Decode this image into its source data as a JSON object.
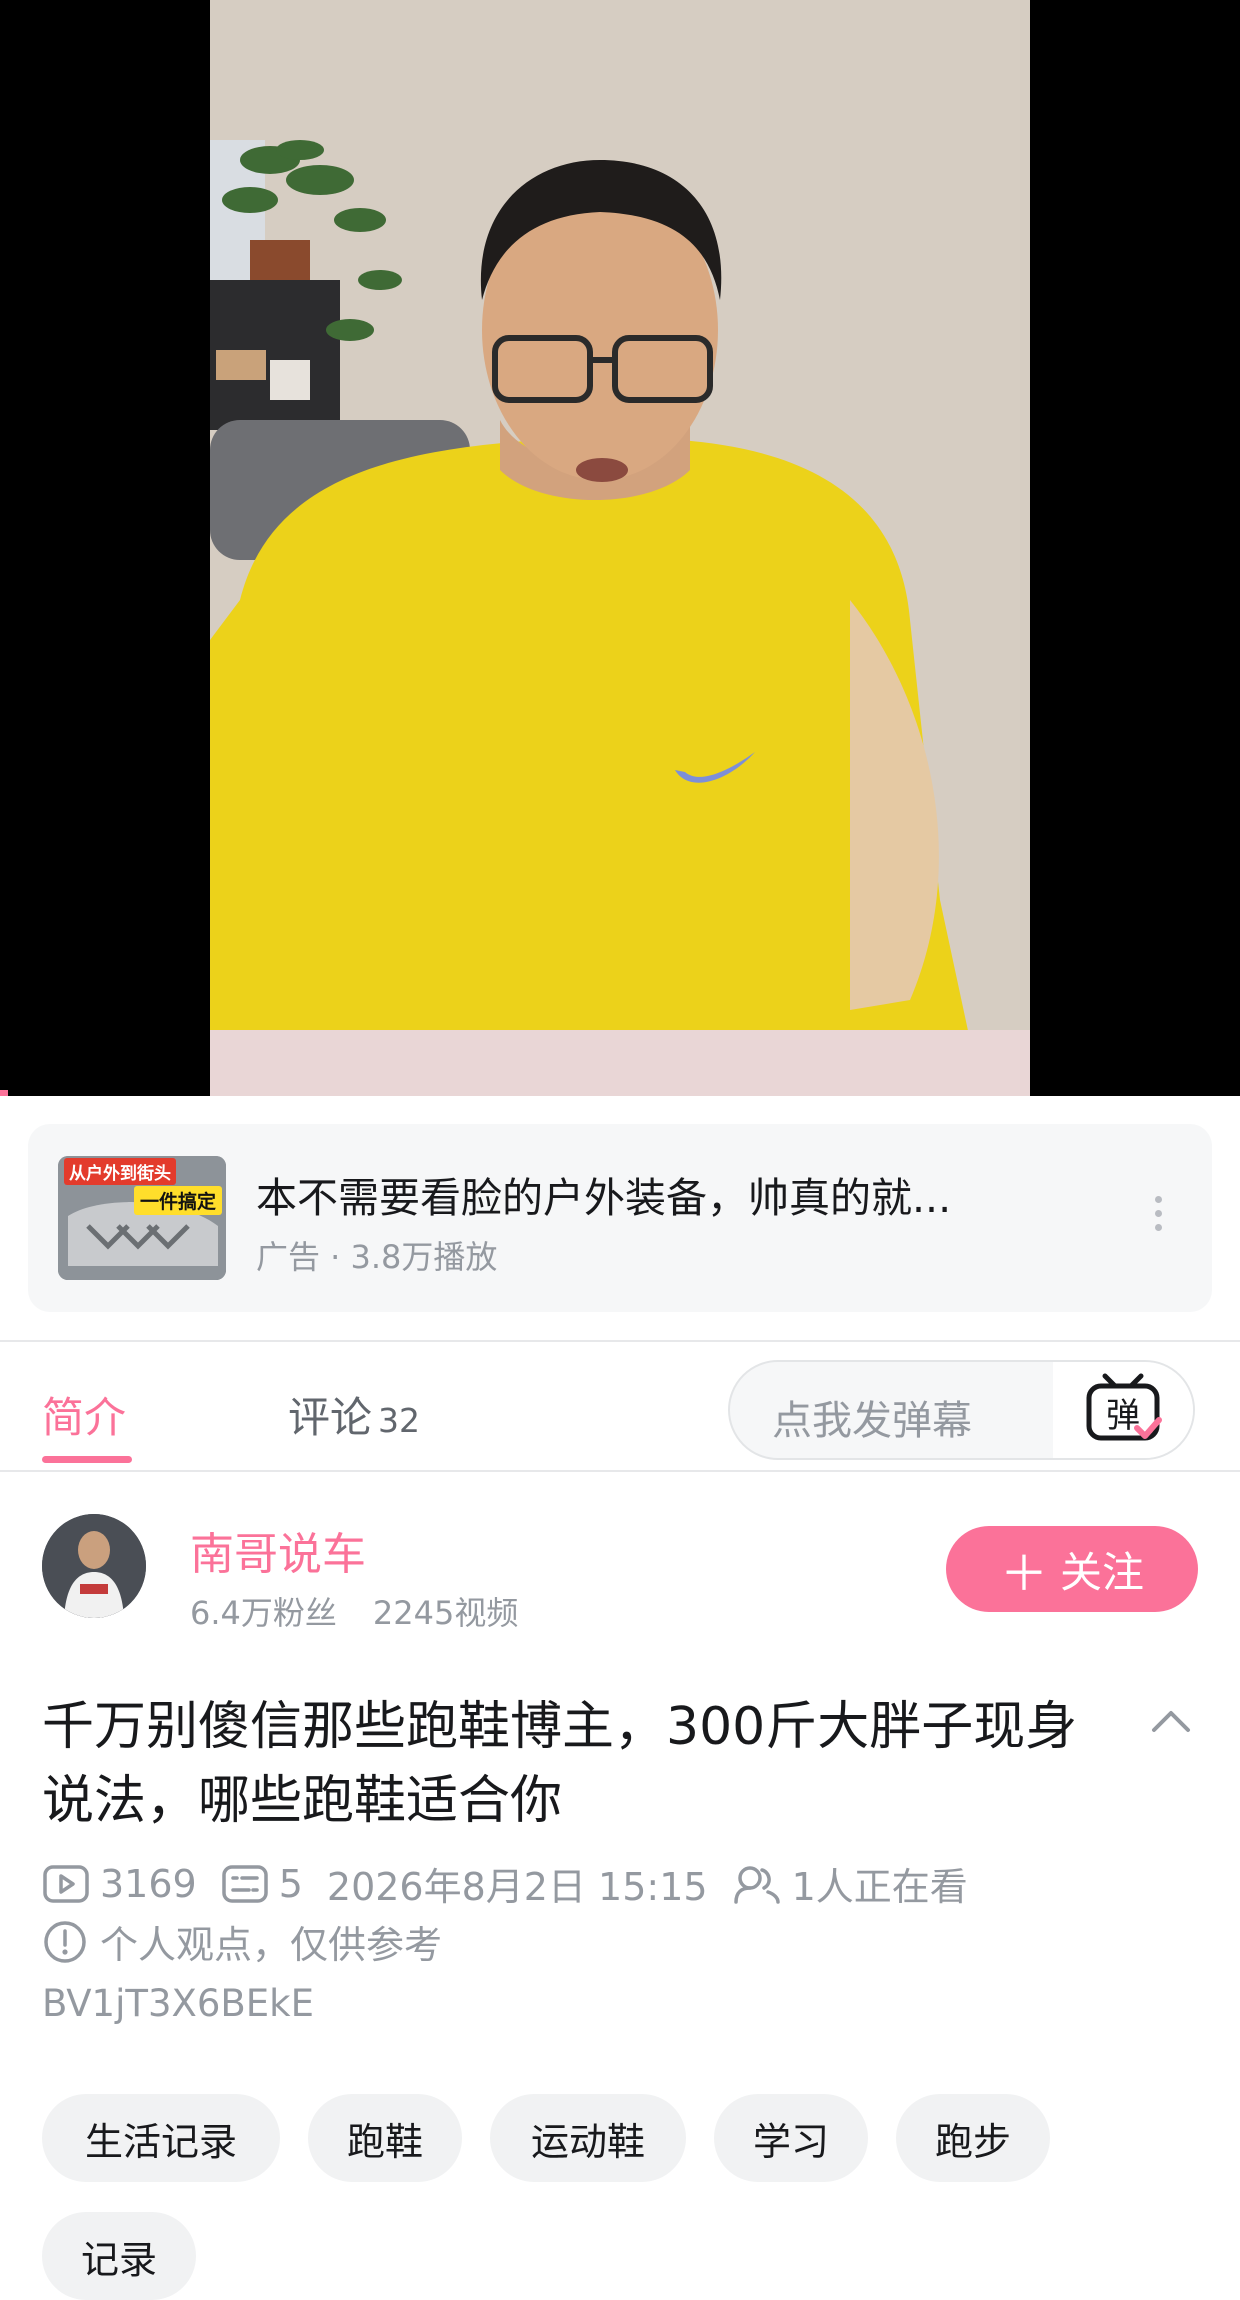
{
  "ad": {
    "title": "本不需要看脸的户外装备，帅真的就...",
    "meta": "广告 · 3.8万播放",
    "thumb_text_top": "从户外到街头",
    "thumb_text_badge": "一件搞定",
    "more_icon": "more-vertical-icon"
  },
  "tabs": {
    "intro": "简介",
    "comments": "评论",
    "comments_count": "32",
    "active": "intro"
  },
  "danmaku": {
    "placeholder": "点我发弹幕",
    "button_glyph": "弹"
  },
  "uploader": {
    "name": "南哥说车",
    "fans": "6.4万粉丝",
    "videos": "2245视频",
    "follow_label": "关注"
  },
  "video": {
    "title": "千万别傻信那些跑鞋博主，300斤大胖子现身说法，哪些跑鞋适合你",
    "plays": "3169",
    "danmaku_count": "5",
    "date": "2026年8月2日 15:15",
    "watching": "1人正在看",
    "notice": "个人观点，仅供参考",
    "bvid": "BV1jT3X6BEkE"
  },
  "tags": [
    "生活记录",
    "跑鞋",
    "运动鞋",
    "学习",
    "跑步",
    "记录"
  ],
  "colors": {
    "accent": "#fb7299",
    "text_primary": "#18191c",
    "text_secondary": "#9499a0",
    "shirt_yellow": "#ecd21a"
  }
}
